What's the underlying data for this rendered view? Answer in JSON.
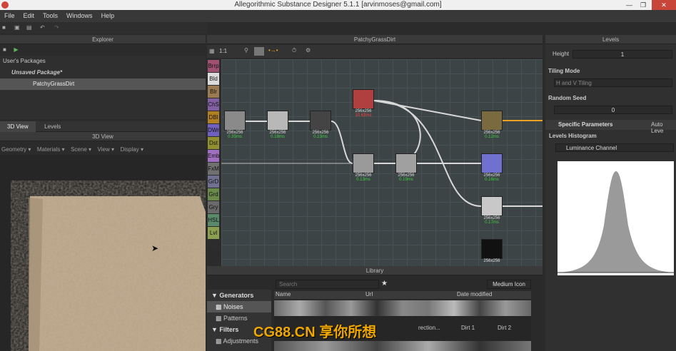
{
  "window": {
    "title": "Allegorithmic Substance Designer 5.1.1 [arvinmoses@gmail.com]"
  },
  "menu": [
    "File",
    "Edit",
    "Tools",
    "Windows",
    "Help"
  ],
  "explorer": {
    "title": "Explorer",
    "section": "User's Packages",
    "package": "Unsaved Package*",
    "graph": "PatchyGrassDirt"
  },
  "view_tabs": [
    "3D View",
    "Levels"
  ],
  "view3d": {
    "title": "3D View",
    "menu": [
      "Geometry ▾",
      "Materials ▾",
      "Scene ▾",
      "View ▾",
      "Display ▾"
    ]
  },
  "graph": {
    "title": "PatchyGrassDirt",
    "zoom": "1:1",
    "library_items": [
      "Brrp",
      "Bld",
      "Blr",
      "ChS",
      "DBl",
      "DWr",
      "Dst",
      "Emb",
      "FxM",
      "GrD",
      "Grd",
      "Gry",
      "HSL",
      "Lvl"
    ],
    "nodes": [
      {
        "res": "256x256",
        "time": "0.35ms"
      },
      {
        "res": "256x256",
        "time": "0.18ms"
      },
      {
        "res": "256x256",
        "time": "0.13ms"
      },
      {
        "res": "256x256",
        "time": "10.63ms"
      },
      {
        "res": "256x256",
        "time": "0.13ms"
      },
      {
        "res": "256x256",
        "time": "0.19ms"
      },
      {
        "res": "256x256",
        "time": "0.12ms"
      },
      {
        "res": "256x256",
        "time": "0.16ms"
      },
      {
        "res": "256x256",
        "time": "0.17ms"
      },
      {
        "res": "256x256",
        "time": ""
      }
    ]
  },
  "library": {
    "title": "Library",
    "search_placeholder": "Search",
    "view_mode": "Medium Icon",
    "columns": [
      "Name",
      "Url",
      "Date modified"
    ],
    "categories": [
      {
        "label": "Generators",
        "kind": "group"
      },
      {
        "label": "Noises",
        "kind": "item"
      },
      {
        "label": "Patterns",
        "kind": "item"
      },
      {
        "label": "Filters",
        "kind": "group"
      },
      {
        "label": "Adjustments",
        "kind": "item"
      }
    ],
    "thumbs": [
      "rection...",
      "Dirt 1",
      "Dirt 2"
    ]
  },
  "properties": {
    "title": "Levels",
    "height_label": "Height",
    "height_value": "1",
    "tiling_label": "Tiling Mode",
    "tiling_value": "H and V Tiling",
    "seed_label": "Random Seed",
    "seed_value": "0",
    "specific": "Specific Parameters",
    "auto_level": "Auto Leve",
    "histogram_label": "Levels Histogram",
    "channel": "Luminance Channel"
  },
  "watermark": "CG88.CN 享你所想"
}
